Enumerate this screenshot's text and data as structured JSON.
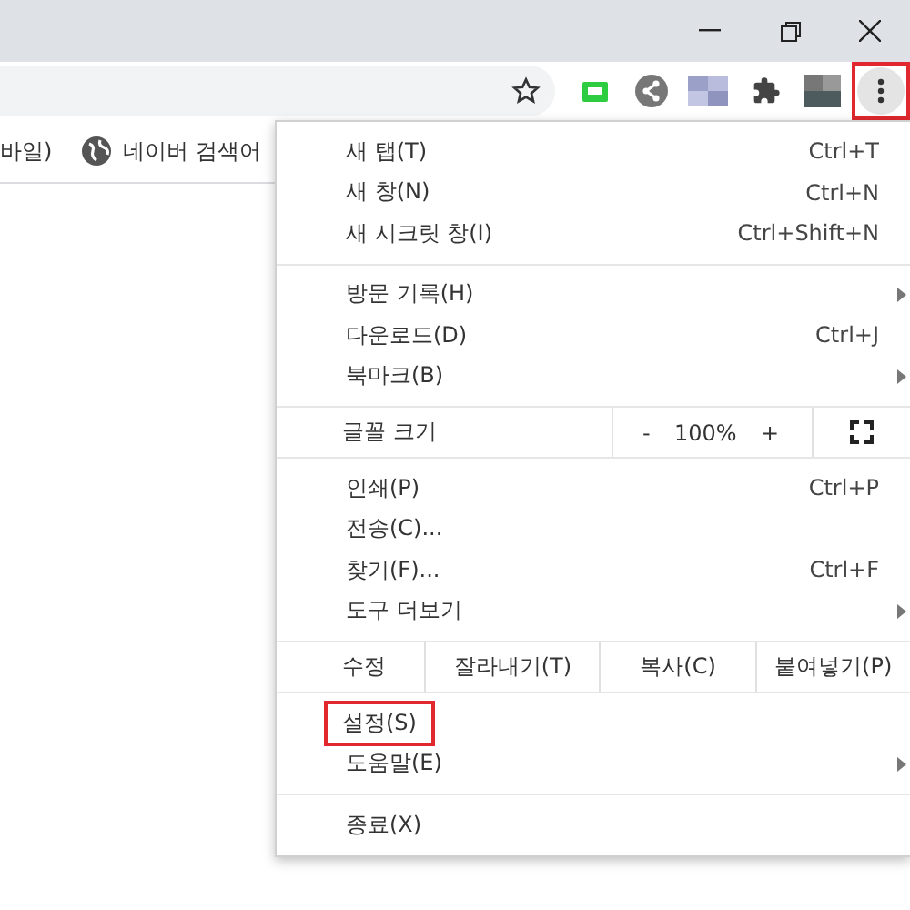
{
  "bookmarks": [
    {
      "label": "바일)",
      "icon": false
    },
    {
      "label": "네이버 검색어",
      "icon": true
    }
  ],
  "toolbar": {
    "menu_button_highlighted": true
  },
  "menu": {
    "groups": [
      {
        "items": [
          {
            "kind": "item",
            "label": "새 탭(T)",
            "shortcut": "Ctrl+T",
            "submenu": false,
            "highlighted": false
          },
          {
            "kind": "item",
            "label": "새 창(N)",
            "shortcut": "Ctrl+N",
            "submenu": false,
            "highlighted": false
          },
          {
            "kind": "item",
            "label": "새 시크릿 창(I)",
            "shortcut": "Ctrl+Shift+N",
            "submenu": false,
            "highlighted": false
          }
        ]
      },
      {
        "items": [
          {
            "kind": "item",
            "label": "방문 기록(H)",
            "submenu": true,
            "highlighted": false
          },
          {
            "kind": "item",
            "label": "다운로드(D)",
            "shortcut": "Ctrl+J",
            "submenu": false,
            "highlighted": false
          },
          {
            "kind": "item",
            "label": "북마크(B)",
            "submenu": true,
            "highlighted": false
          }
        ]
      },
      {
        "items": [
          {
            "kind": "zoom",
            "label": "글꼴 크기",
            "minus": "-",
            "value": "100%",
            "plus": "+"
          }
        ]
      },
      {
        "items": [
          {
            "kind": "item",
            "label": "인쇄(P)",
            "shortcut": "Ctrl+P",
            "submenu": false,
            "highlighted": false
          },
          {
            "kind": "item",
            "label": "전송(C)...",
            "submenu": false,
            "highlighted": false
          },
          {
            "kind": "item",
            "label": "찾기(F)...",
            "shortcut": "Ctrl+F",
            "submenu": false,
            "highlighted": false
          },
          {
            "kind": "item",
            "label": "도구 더보기",
            "submenu": true,
            "highlighted": false
          }
        ]
      },
      {
        "items": [
          {
            "kind": "edit",
            "label": "수정",
            "actions": [
              "잘라내기(T)",
              "복사(C)",
              "붙여넣기(P)"
            ]
          }
        ]
      },
      {
        "items": [
          {
            "kind": "item",
            "label": "설정(S)",
            "submenu": false,
            "highlighted": true
          },
          {
            "kind": "item",
            "label": "도움말(E)",
            "submenu": true,
            "highlighted": false
          }
        ]
      },
      {
        "items": [
          {
            "kind": "item",
            "label": "종료(X)",
            "submenu": false,
            "highlighted": false
          }
        ]
      }
    ]
  }
}
